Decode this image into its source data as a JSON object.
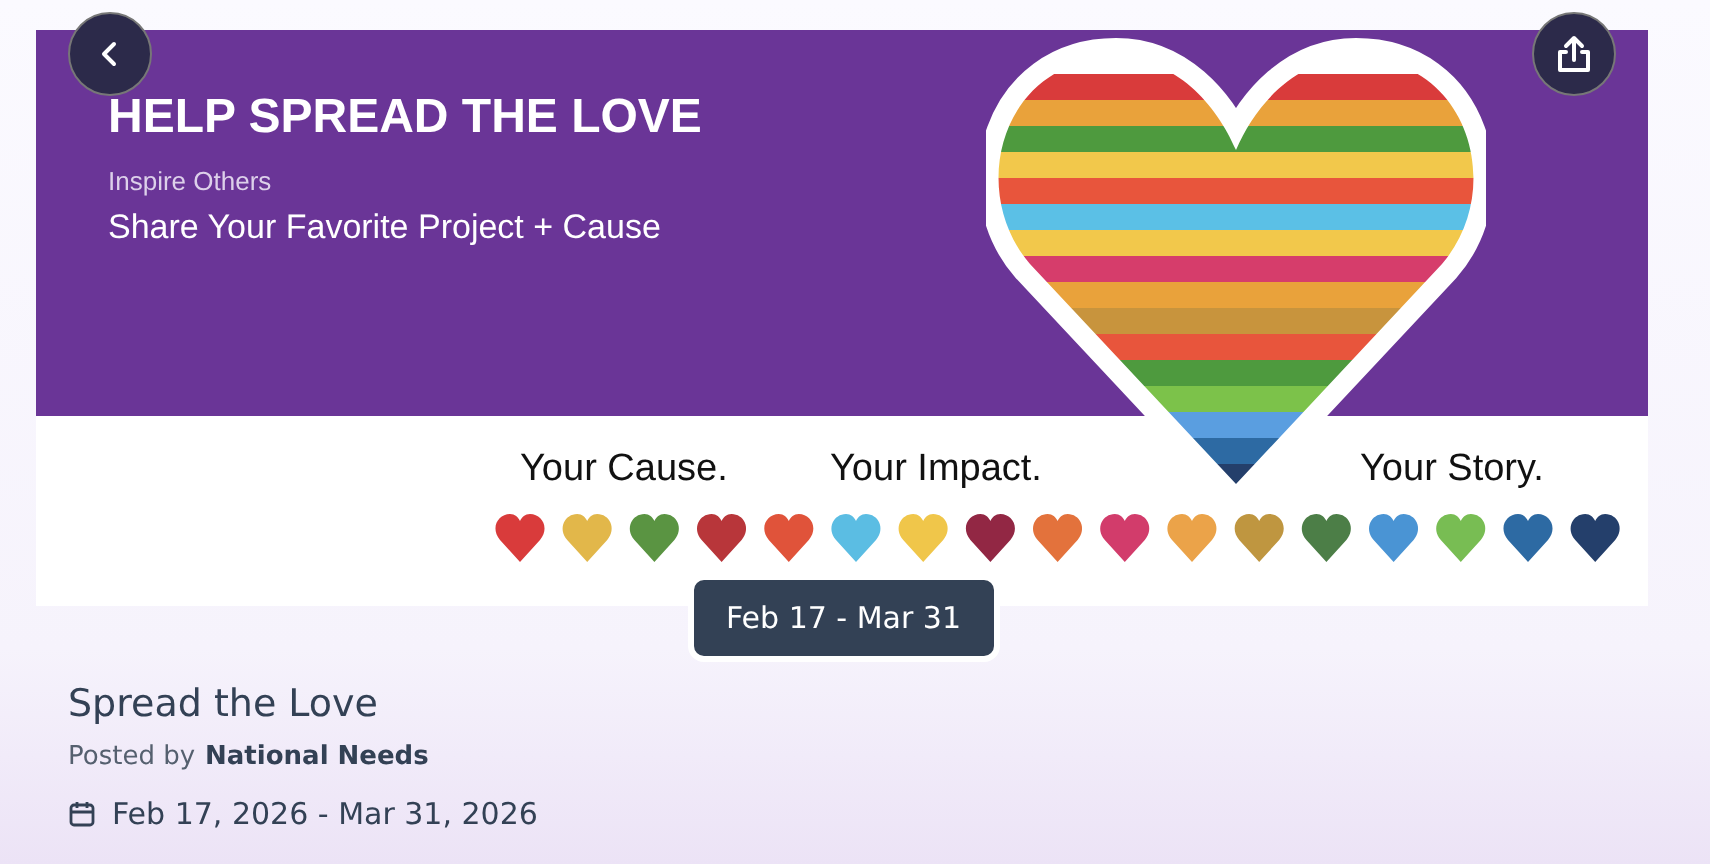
{
  "banner": {
    "headline": "HELP SPREAD THE LOVE",
    "subheadline": "Inspire Others",
    "tagline": "Share Your Favorite Project + Cause",
    "slogans": [
      "Your Cause.",
      "Your Impact.",
      "Your Story."
    ]
  },
  "date_badge": "Feb 17 - Mar 31",
  "post": {
    "title": "Spread the Love",
    "posted_by": "Posted by",
    "author": "National Needs",
    "dates": "Feb 17, 2026 - Mar 31, 2026"
  }
}
